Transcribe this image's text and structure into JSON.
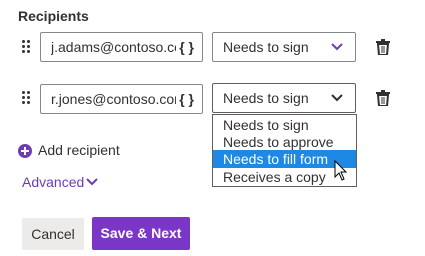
{
  "section_title": "Recipients",
  "recipients": [
    {
      "email": "j.adams@contoso.com",
      "role": "Needs to sign"
    },
    {
      "email": "r.jones@contoso.com",
      "role": "Needs to sign"
    }
  ],
  "role_options": [
    "Needs to sign",
    "Needs to approve",
    "Needs to fill form",
    "Receives a copy"
  ],
  "highlighted_option": "Needs to fill form",
  "add_recipient_label": "Add recipient",
  "advanced_label": "Advanced",
  "buttons": {
    "cancel": "Cancel",
    "save_next": "Save & Next"
  },
  "icons": {
    "drag": "drag-handle-icon",
    "braces": "braces-icon",
    "chevron": "chevron-down-icon",
    "trash": "trash-icon",
    "add": "plus-circle-icon",
    "cursor": "mouse-pointer-icon"
  },
  "colors": {
    "accent": "#7a37c7",
    "link": "#6d3cb4",
    "highlight": "#1e88e5",
    "cancel_bg": "#edebe9"
  }
}
